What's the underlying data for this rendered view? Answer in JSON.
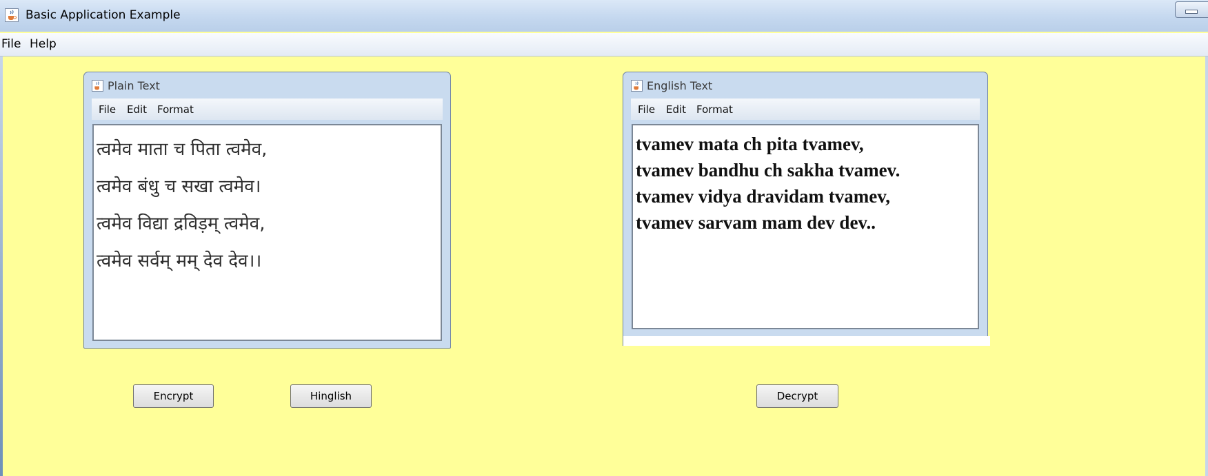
{
  "window": {
    "title": "Basic Application Example"
  },
  "menubar": {
    "items": [
      "File",
      "Help"
    ]
  },
  "plain_frame": {
    "title": "Plain Text",
    "menu": [
      "File",
      "Edit",
      "Format"
    ],
    "lines": [
      "त्वमेव माता च पिता त्वमेव,",
      "त्वमेव बंधु च सखा त्वमेव।",
      "त्वमेव विद्या द्रविड़म् त्वमेव,",
      "त्वमेव सर्वम् मम् देव देव।।"
    ]
  },
  "english_frame": {
    "title": "English Text",
    "menu": [
      "File",
      "Edit",
      "Format"
    ],
    "lines": [
      "tvamev mata ch pita tvamev,",
      "tvamev bandhu ch sakha tvamev.",
      "tvamev vidya dravidam tvamev,",
      "tvamev sarvam mam dev dev.."
    ]
  },
  "buttons": {
    "encrypt": "Encrypt",
    "hinglish": "Hinglish",
    "decrypt": "Decrypt"
  },
  "icons": {
    "app": "java-cup-icon",
    "minimize": "minimize-icon"
  },
  "colors": {
    "background": "#ffff99",
    "frame": "#c9dbef"
  }
}
